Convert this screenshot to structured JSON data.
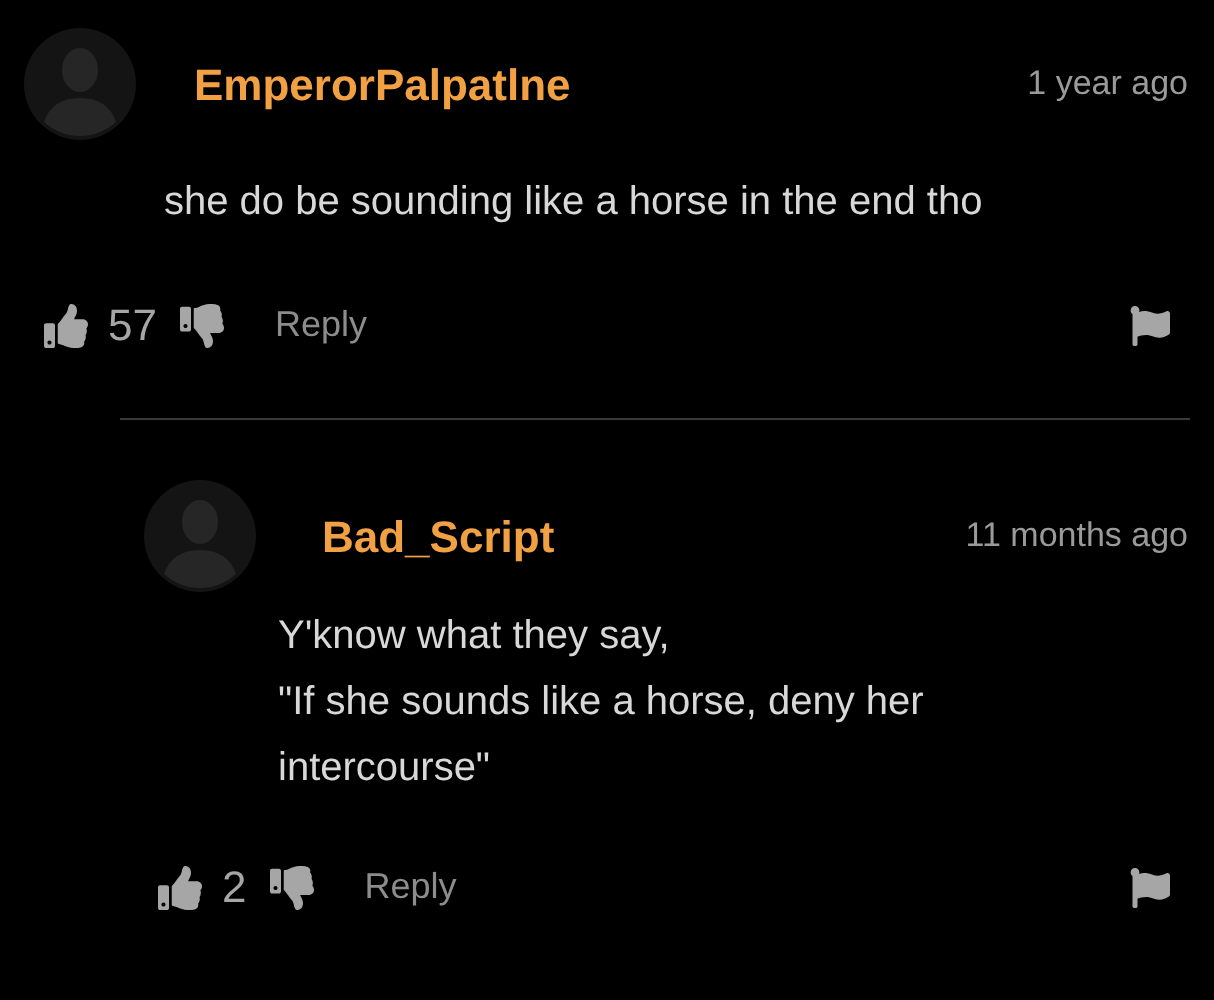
{
  "comments": [
    {
      "author": "EmperorPalpatlne",
      "time": "1 year ago",
      "text": "she do be sounding like a horse in the end tho",
      "likes": "57",
      "reply_label": "Reply",
      "replies": [
        {
          "author": "Bad_Script",
          "time": "11 months ago",
          "text": "Y'know what they say,\n\"If she sounds like a horse, deny her intercourse\"",
          "likes": "2",
          "reply_label": "Reply"
        }
      ]
    }
  ]
}
